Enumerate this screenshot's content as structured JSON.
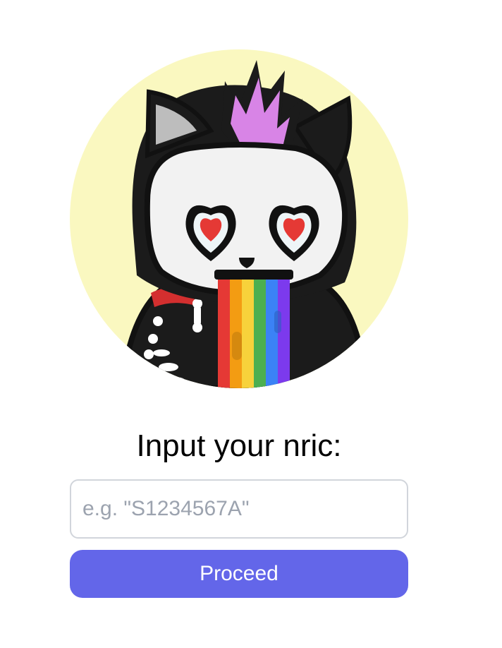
{
  "avatar": {
    "icon": "rainbow-skeleton-cat-avatar",
    "background_color": "#faf8c0",
    "rainbow_colors": [
      "#e53935",
      "#f39c12",
      "#f7d23b",
      "#4caf50",
      "#3b82f6",
      "#7c3aed"
    ]
  },
  "form": {
    "prompt_label": "Input your nric:",
    "nric_placeholder": "e.g. \"S1234567A\"",
    "nric_value": "",
    "proceed_label": "Proceed"
  },
  "colors": {
    "accent": "#6366e9",
    "input_border": "#d1d5db",
    "placeholder": "#9ca3af"
  }
}
